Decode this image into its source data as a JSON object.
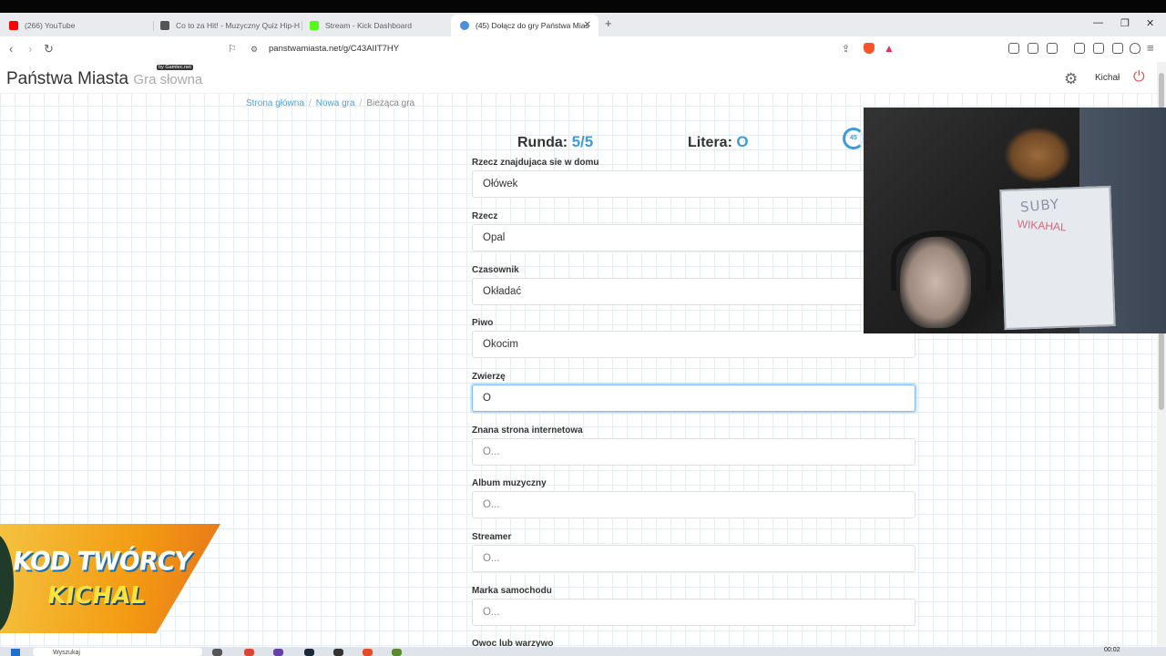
{
  "browser": {
    "tabs": [
      {
        "title": "(266) YouTube",
        "favicon_color": "#ff0000"
      },
      {
        "title": "Co to za Hit! - Muzyczny Quiz Hip-H",
        "favicon_color": "#555555"
      },
      {
        "title": "Stream - Kick Dashboard",
        "favicon_color": "#53fc18"
      },
      {
        "title": "(45) Dołącz do gry Państwa Mias",
        "favicon_color": "#4a90d9"
      }
    ],
    "new_tab": "+",
    "url": "panstwamiasta.net/g/C43AIIT7HY"
  },
  "site": {
    "brand": "Państwa Miasta",
    "brand_sub": "Gra słowna",
    "badge": "by Gamtec.net",
    "user": "Kichał"
  },
  "breadcrumb": [
    "Strona główna",
    "Nowa gra",
    "Bieżąca gra"
  ],
  "game": {
    "round_label": "Runda:",
    "round_value": "5/5",
    "letter_label": "Litera:",
    "letter_value": "O",
    "timer": "45"
  },
  "fields": [
    {
      "label": "Rzecz znajdujaca sie w domu",
      "value": "Ołówek",
      "placeholder": ""
    },
    {
      "label": "Rzecz",
      "value": "Opal",
      "placeholder": ""
    },
    {
      "label": "Czasownik",
      "value": "Okładać",
      "placeholder": ""
    },
    {
      "label": "Piwo",
      "value": "Okocim",
      "placeholder": ""
    },
    {
      "label": "Zwierzę",
      "value": "O",
      "placeholder": ""
    },
    {
      "label": "Znana strona internetowa",
      "value": "",
      "placeholder": "O..."
    },
    {
      "label": "Album muzyczny",
      "value": "",
      "placeholder": "O..."
    },
    {
      "label": "Streamer",
      "value": "",
      "placeholder": "O..."
    },
    {
      "label": "Marka samochodu",
      "value": "",
      "placeholder": "O..."
    },
    {
      "label": "Owoc lub warzywo",
      "value": "",
      "placeholder": ""
    }
  ],
  "overlay": {
    "promo_line1": "KOD TWÓRCY",
    "promo_line2": "KICHAL",
    "whiteboard_text": "SUBY",
    "whiteboard_text2": "WIKAHAL"
  },
  "taskbar": {
    "search_placeholder": "Wyszukaj",
    "time": "00:02"
  }
}
